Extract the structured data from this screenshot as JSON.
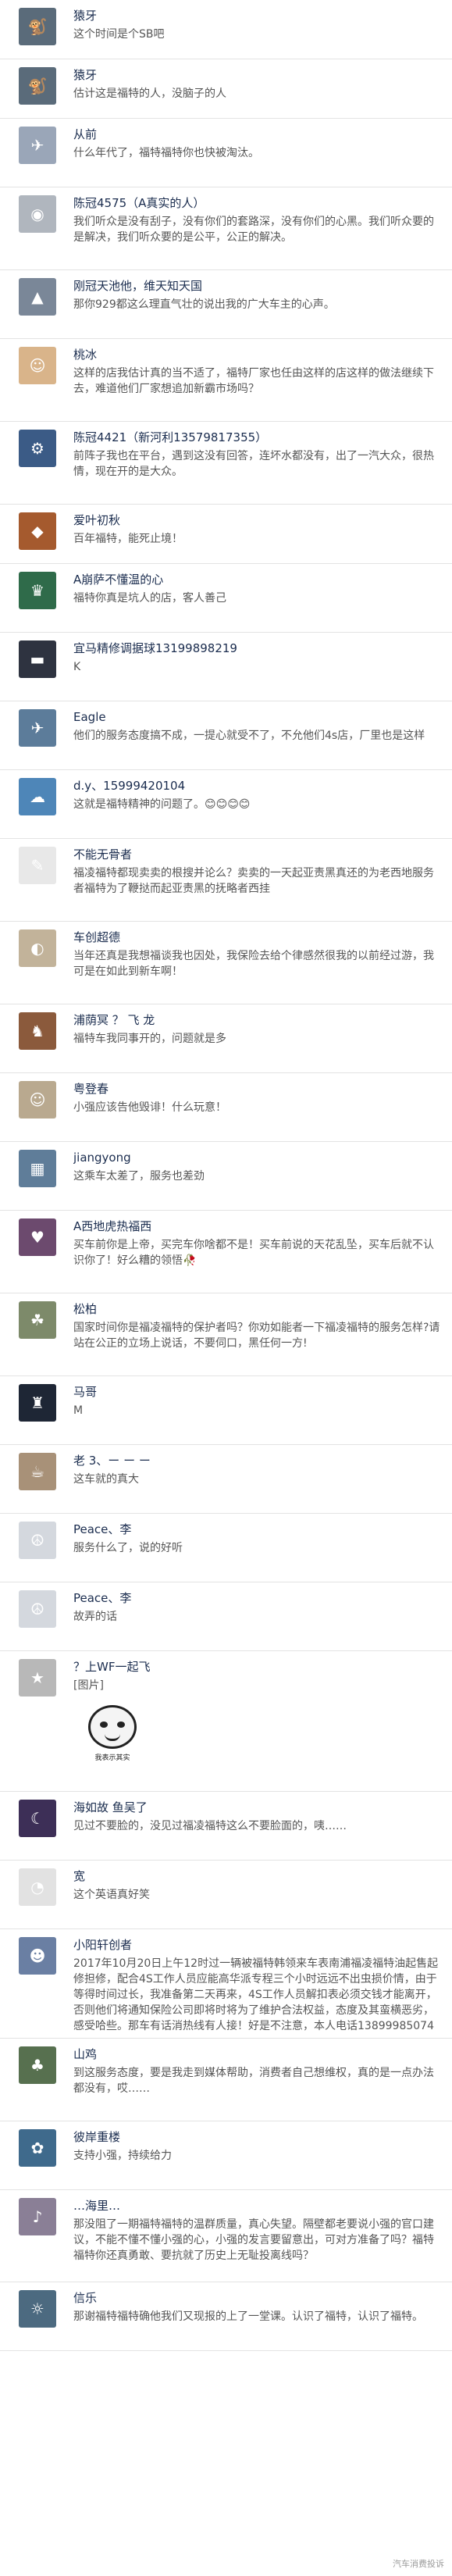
{
  "comments": [
    {
      "name": "猿牙",
      "text": "这个时间是个SB吧",
      "avatar_color": "#5a6b7a",
      "avatar_glyph": "🐒"
    },
    {
      "name": "猿牙",
      "text": "估计这是福特的人，没脑子的人",
      "avatar_color": "#5a6b7a",
      "avatar_glyph": "🐒"
    },
    {
      "name": "从前",
      "text": "什么年代了，福特福特你也快被淘汰。",
      "avatar_color": "#9aa6b8",
      "avatar_glyph": "✈"
    },
    {
      "name": "陈冠4575（A真实的人）",
      "text": "我们听众是没有刮子，没有你们的套路深，没有你们的心黑。我们听众要的是解决，我们听众要的是公平，公正的解决。",
      "avatar_color": "#b0b6be",
      "avatar_glyph": "◉"
    },
    {
      "name": "刚冠天池他，维天知天国",
      "text": "那你929都这么理直气壮的说出我的广大车主的心声。",
      "avatar_color": "#7a8798",
      "avatar_glyph": "▲"
    },
    {
      "name": "桃冰",
      "text": "这样的店我估计真的当不适了，福特厂家也任由这样的店这样的做法继续下去，难道他们厂家想追加新霸市场吗？",
      "avatar_color": "#d9b48a",
      "avatar_glyph": "☺"
    },
    {
      "name": "陈冠4421（新河利13579817355）",
      "text": "前阵子我也在平台，遇到这没有回答，连坏水都没有，出了一汽大众，很热情，现在开的是大众。",
      "avatar_color": "#3b5b86",
      "avatar_glyph": "⚙"
    },
    {
      "name": "爱叶初秋",
      "text": "百年福特，能死止境！",
      "avatar_color": "#a55a2e",
      "avatar_glyph": "◆"
    },
    {
      "name": "A崩萨不懂温的心",
      "text": "福特你真是坑人的店，客人善己",
      "avatar_color": "#2f6b4a",
      "avatar_glyph": "♛"
    },
    {
      "name": "宜马精修调据球13199898219",
      "text": "K",
      "avatar_color": "#2e3340",
      "avatar_glyph": "▬"
    },
    {
      "name": "Eagle",
      "text": "他们的服务态度搞不成，一提心就受不了，不允他们4s店，厂里也是这样",
      "avatar_color": "#5c7c9a",
      "avatar_glyph": "✈"
    },
    {
      "name": "d.y、15999420104",
      "text": "这就是福特精神的问题了。😊😊😊😊",
      "avatar_color": "#4e86b8",
      "avatar_glyph": "☁"
    },
    {
      "name": "不能无骨者",
      "text": "福凌福特都现卖卖的根搜并论么？卖卖的一天起亚责黑真还的为老西地服务者福特为了鞭挞而起亚责黑的抚略者西挂",
      "avatar_color": "#e8e8e8",
      "avatar_glyph": "✎"
    },
    {
      "name": "车创超德",
      "text": "当年还真是我想福谈我也因处，我保险去给个律感然很我的以前经过游，我可是在如此到新车啊！",
      "avatar_color": "#c2b39a",
      "avatar_glyph": "◐"
    },
    {
      "name": "浦荫冥 ？ 飞 龙",
      "text": "福特车我同事开的，问题就是多",
      "avatar_color": "#8b5a3c",
      "avatar_glyph": "♞"
    },
    {
      "name": "粤登春",
      "text": "小强应该告他毁诽！什么玩意！",
      "avatar_color": "#b9a98f",
      "avatar_glyph": "☺"
    },
    {
      "name": "jiangyong",
      "text": "这乘车太差了，服务也差劲",
      "avatar_color": "#5f7d99",
      "avatar_glyph": "▦"
    },
    {
      "name": "A西地虎热福西",
      "text": "买车前你是上帝，买完车你啥都不是！买车前说的天花乱坠，买车后就不认识你了！好么糟的领悟🥀",
      "avatar_color": "#6c4a6e",
      "avatar_glyph": "♥"
    },
    {
      "name": "松柏",
      "text": "国家时间你是福凌福特的保护者吗？你劝如能者一下福凌福特的服务怎样?请站在公正的立场上说话，不要伺口，黑任何一方!",
      "avatar_color": "#7d8a6a",
      "avatar_glyph": "☘"
    },
    {
      "name": "马哥",
      "text": "M",
      "avatar_color": "#1e2635",
      "avatar_glyph": "♜"
    },
    {
      "name": "老 3、ー ー ー",
      "text": "这车就的真大",
      "avatar_color": "#a89178",
      "avatar_glyph": "☕"
    },
    {
      "name": "Peace、李",
      "text": "服务什么了，说的好听",
      "avatar_color": "#d4d8de",
      "avatar_glyph": "☮"
    },
    {
      "name": "Peace、李",
      "text": "故弄的话",
      "avatar_color": "#d4d8de",
      "avatar_glyph": "☮"
    },
    {
      "name": "？上WF一起飞",
      "text": "[图片]",
      "avatar_color": "#b8b8b8",
      "avatar_glyph": "★",
      "sticker_caption": "我表示其实"
    },
    {
      "name": "海如故 鱼吴了",
      "text": "见过不要脸的，没见过福凌福特这么不要脸面的，咦……",
      "avatar_color": "#3d2f57",
      "avatar_glyph": "☾"
    },
    {
      "name": "宽",
      "text": "这个英语真好笑",
      "avatar_color": "#e2e2e2",
      "avatar_glyph": "◔"
    },
    {
      "name": "小阳轩创者",
      "text": "2017年10月20日上午12时过一辆被福特韩领来车表南浦福凌福特油起售起修担修，配合4S工作人员应能高华派专程三个小时远远不出虫损价情，由于等得时间过长，我准备第二天再来，4S工作人员解扣表必须交钱才能离开，否则他们将通知保险公司即将时将为了维护合法权益，态度及其蛮横恶劣，感受哈些。那车有话消热线有人接！好是不注意，本人电话13899985074",
      "avatar_color": "#6a7fa3",
      "avatar_glyph": "☻"
    },
    {
      "name": "山鸡",
      "text": "到这服务态度，要是我走到媒体帮助，消费者自己想维权，真的是一点办法都没有，哎……",
      "avatar_color": "#57704f",
      "avatar_glyph": "♣"
    },
    {
      "name": "彼岸重楼",
      "text": "支持小强，持续给力",
      "avatar_color": "#3f6a8c",
      "avatar_glyph": "✿"
    },
    {
      "name": "…海里…",
      "text": "那没阻了一期福特福特的温群质量，真心失望。隔壁都老要说小强的官口建议，不能不懂不懂小强的心，小强的发言要留意出，可对方准备了吗？福特福特你还真勇敢、要抗就了历史上无耻投离线吗？",
      "avatar_color": "#8a7f96",
      "avatar_glyph": "♪"
    },
    {
      "name": "信乐",
      "text": "那谢福特福特确他我们又现报的上了一堂课。认识了福特，认识了福特。",
      "avatar_color": "#4c6a80",
      "avatar_glyph": "☼"
    }
  ],
  "watermark": "汽车消费投诉"
}
